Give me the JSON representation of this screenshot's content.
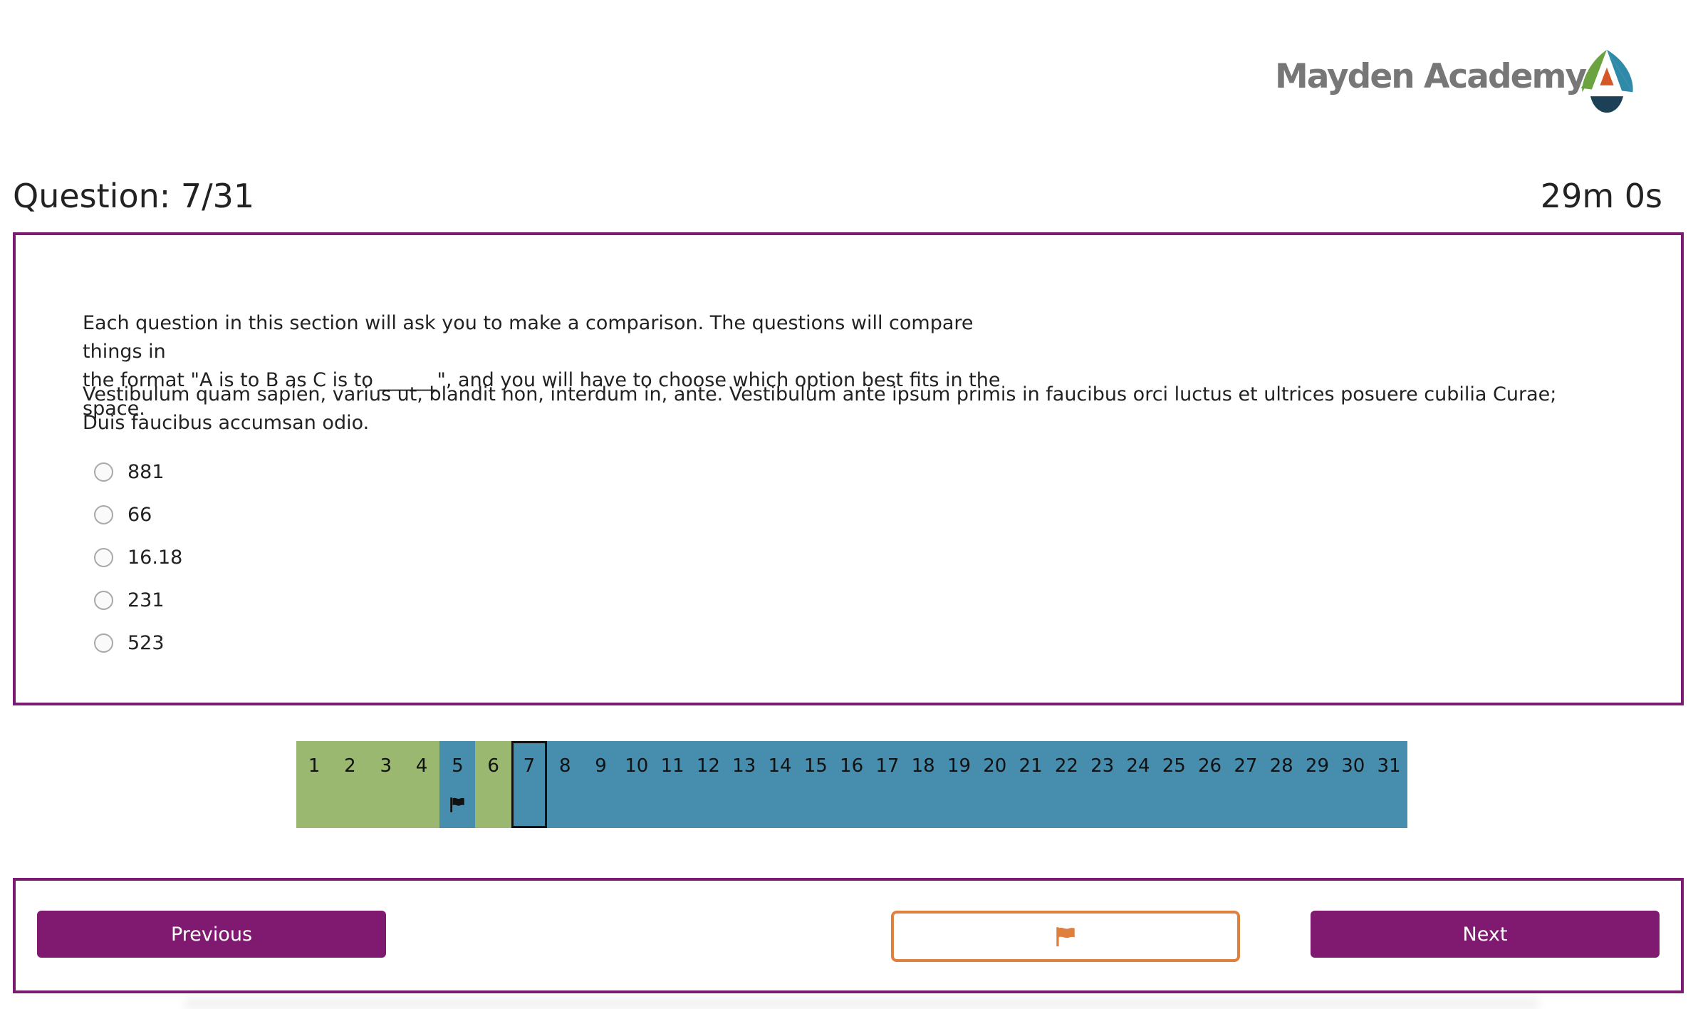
{
  "brand": {
    "name": "Mayden Academy",
    "logo_colors": {
      "green": "#6aa340",
      "teal": "#2e8aa8",
      "navy": "#1c4157",
      "orange": "#d4572a",
      "text": "#777777"
    }
  },
  "header": {
    "question_label": "Question: 7/31",
    "timer": "29m 0s"
  },
  "question": {
    "intro_line_1": "Each question in this section will ask you to make a comparison. The questions will compare things in",
    "intro_line_2": "the format \"A is to B as C is to ______\", and you will have to choose which option best fits in the space.",
    "body": "Vestibulum quam sapien, varius ut, blandit non, interdum in, ante. Vestibulum ante ipsum primis in faucibus orci luctus et ultrices posuere cubilia Curae; Duis faucibus accumsan odio.",
    "options": [
      "881",
      "66",
      "16.18",
      "231",
      "523"
    ]
  },
  "navigator": {
    "current": 7,
    "answered_color": "#9ab870",
    "unanswered_color": "#478eae",
    "items": [
      {
        "label": "1",
        "state": "answered",
        "flagged": false
      },
      {
        "label": "2",
        "state": "answered",
        "flagged": false
      },
      {
        "label": "3",
        "state": "answered",
        "flagged": false
      },
      {
        "label": "4",
        "state": "answered",
        "flagged": false
      },
      {
        "label": "5",
        "state": "unanswered",
        "flagged": true
      },
      {
        "label": "6",
        "state": "answered",
        "flagged": false
      },
      {
        "label": "7",
        "state": "unanswered",
        "flagged": false
      },
      {
        "label": "8",
        "state": "unanswered",
        "flagged": false
      },
      {
        "label": "9",
        "state": "unanswered",
        "flagged": false
      },
      {
        "label": "10",
        "state": "unanswered",
        "flagged": false
      },
      {
        "label": "11",
        "state": "unanswered",
        "flagged": false
      },
      {
        "label": "12",
        "state": "unanswered",
        "flagged": false
      },
      {
        "label": "13",
        "state": "unanswered",
        "flagged": false
      },
      {
        "label": "14",
        "state": "unanswered",
        "flagged": false
      },
      {
        "label": "15",
        "state": "unanswered",
        "flagged": false
      },
      {
        "label": "16",
        "state": "unanswered",
        "flagged": false
      },
      {
        "label": "17",
        "state": "unanswered",
        "flagged": false
      },
      {
        "label": "18",
        "state": "unanswered",
        "flagged": false
      },
      {
        "label": "19",
        "state": "unanswered",
        "flagged": false
      },
      {
        "label": "20",
        "state": "unanswered",
        "flagged": false
      },
      {
        "label": "21",
        "state": "unanswered",
        "flagged": false
      },
      {
        "label": "22",
        "state": "unanswered",
        "flagged": false
      },
      {
        "label": "23",
        "state": "unanswered",
        "flagged": false
      },
      {
        "label": "24",
        "state": "unanswered",
        "flagged": false
      },
      {
        "label": "25",
        "state": "unanswered",
        "flagged": false
      },
      {
        "label": "26",
        "state": "unanswered",
        "flagged": false
      },
      {
        "label": "27",
        "state": "unanswered",
        "flagged": false
      },
      {
        "label": "28",
        "state": "unanswered",
        "flagged": false
      },
      {
        "label": "29",
        "state": "unanswered",
        "flagged": false
      },
      {
        "label": "30",
        "state": "unanswered",
        "flagged": false
      },
      {
        "label": "31",
        "state": "unanswered",
        "flagged": false
      }
    ]
  },
  "footer": {
    "previous_label": "Previous",
    "next_label": "Next",
    "flag_icon": "flag-icon",
    "flag_color": "#e0803e",
    "button_color": "#7f1a70",
    "border_color": "#7b1c72"
  }
}
